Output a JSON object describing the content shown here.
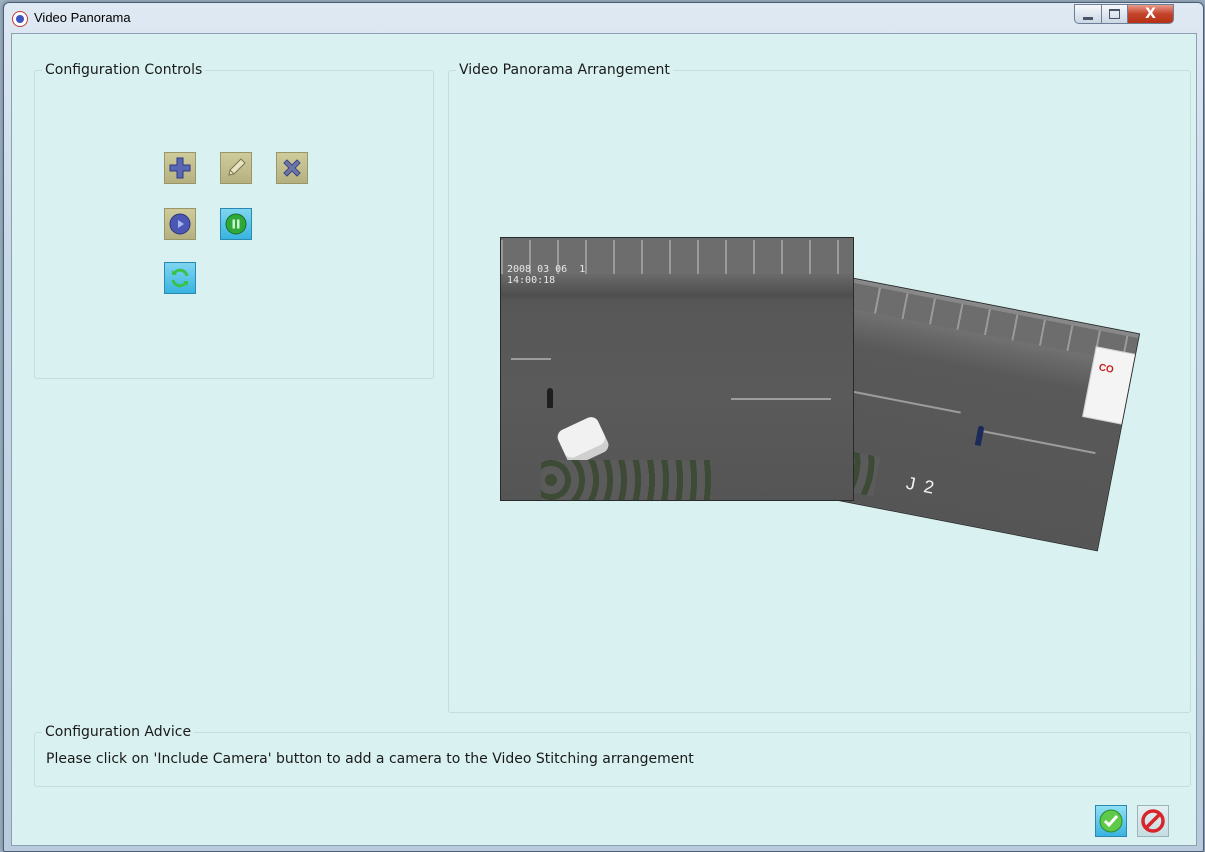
{
  "window": {
    "title": "Video Panorama",
    "controls": {
      "minimize": "–",
      "maximize": "□",
      "close": "X"
    }
  },
  "configuration_controls": {
    "legend": "Configuration Controls",
    "tools": [
      {
        "name": "include-camera",
        "icon": "plus-icon"
      },
      {
        "name": "edit-camera",
        "icon": "pencil-icon"
      },
      {
        "name": "remove-camera",
        "icon": "x-icon"
      },
      {
        "name": "play",
        "icon": "play-icon"
      },
      {
        "name": "pause",
        "icon": "pause-icon"
      },
      {
        "name": "refresh",
        "icon": "refresh-icon"
      }
    ]
  },
  "arrangement": {
    "legend": "Video Panorama Arrangement",
    "cameras": [
      {
        "id": "cam-1",
        "osd": "2008 03 06  1\n14:00:18"
      },
      {
        "id": "cam-2",
        "label": "J 2",
        "truck_logo": "CO"
      }
    ]
  },
  "advice": {
    "legend": "Configuration Advice",
    "text": "Please click on 'Include Camera' button to add a camera to the Video Stitching arrangement"
  },
  "footer": {
    "ok_icon": "checkmark-icon",
    "cancel_icon": "prohibited-icon"
  },
  "colors": {
    "client_bg": "#d9f2f1",
    "tool_olive": "#c2be8c",
    "tool_cyan": "#38b4e0",
    "close_red": "#c5432a"
  }
}
